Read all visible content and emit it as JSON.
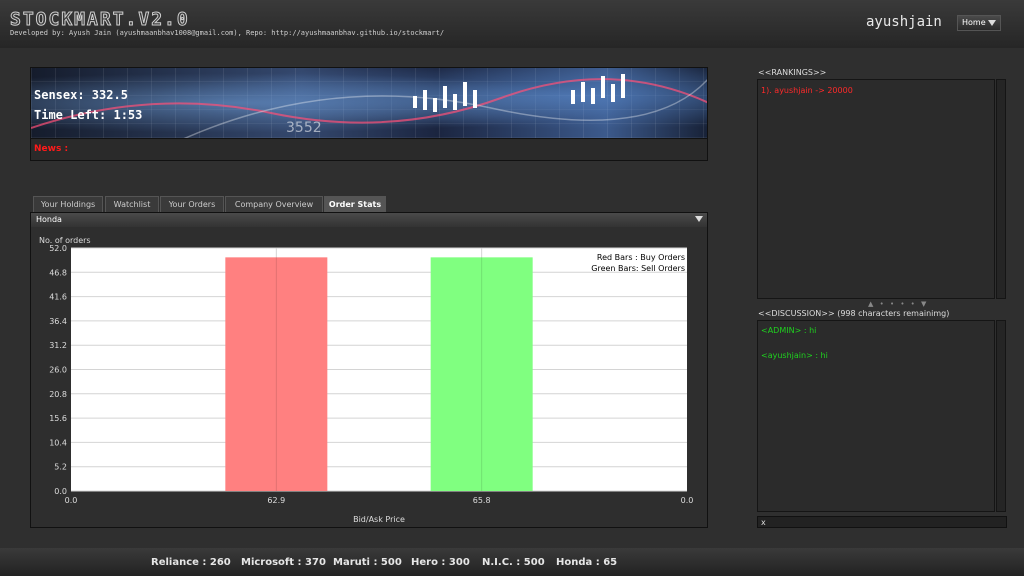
{
  "header": {
    "title": "STOCKMART.V2.0",
    "subtitle": "Developed by: Ayush Jain (ayushmaanbhav1008@gmail.com), Repo: http://ayushmaanbhav.github.io/stockmart/",
    "username": "ayushjain",
    "home_label": "Home"
  },
  "banner": {
    "sensex": "Sensex: 332.5",
    "time_left": "Time Left: 1:53",
    "news_label": "News :"
  },
  "tabs": [
    {
      "label": "Your Holdings"
    },
    {
      "label": "Watchlist"
    },
    {
      "label": "Your Orders"
    },
    {
      "label": "Company Overview"
    },
    {
      "label": "Order Stats",
      "active": true
    }
  ],
  "panel": {
    "company": "Honda"
  },
  "chart_data": {
    "type": "bar",
    "ylabel": "No. of orders",
    "xlabel": "Bid/Ask Price",
    "ylim": [
      0,
      52
    ],
    "yticks": [
      "0.0",
      "5.2",
      "10.4",
      "15.6",
      "20.8",
      "26.0",
      "31.2",
      "36.4",
      "41.6",
      "46.8",
      "52.0"
    ],
    "xticks": [
      "0.0",
      "62.9",
      "65.8",
      "0.0"
    ],
    "bars": [
      {
        "x": 62.9,
        "value": 50,
        "kind": "buy",
        "color": "#ff8080"
      },
      {
        "x": 65.8,
        "value": 50,
        "kind": "sell",
        "color": "#80ff80"
      }
    ],
    "legend": {
      "line1": "Red Bars   : Buy Orders",
      "line2": "Green Bars: Sell Orders",
      "placement": "top-right"
    },
    "grid": true
  },
  "rankings": {
    "label": "<<RANKINGS>>",
    "items": [
      "1). ayushjain -> 20000"
    ]
  },
  "discussion": {
    "label": "<<DISCUSSION>> (998 characters remainimg)",
    "messages": [
      "<ADMIN> : hi",
      "<ayushjain> : hi"
    ],
    "input_value": "x"
  },
  "ticker": [
    "Reliance : 260",
    "Microsoft : 370",
    "Maruti : 500",
    "Hero : 300",
    "N.I.C. : 500",
    "Honda : 65"
  ],
  "colors": {
    "news": "#ff1a1a",
    "ranking": "#ff2a2a",
    "chat": "#1fd11f",
    "buy_bar": "#ff8080",
    "sell_bar": "#80ff80"
  }
}
